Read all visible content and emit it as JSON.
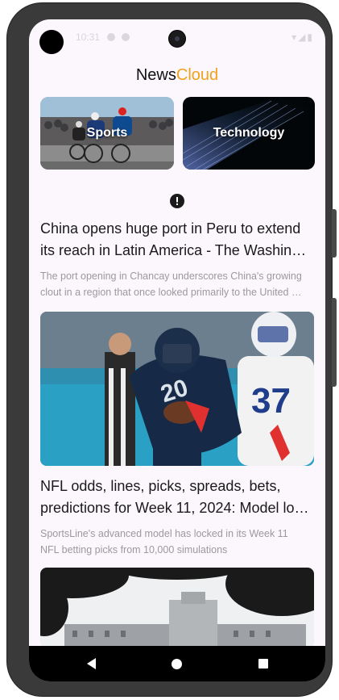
{
  "status_bar": {
    "time": "10:31"
  },
  "app": {
    "title_prefix": "News",
    "title_accent": "Cloud",
    "accent_color": "#f2a11b"
  },
  "categories": [
    {
      "label": "Sports"
    },
    {
      "label": "Technology"
    }
  ],
  "error_icon": "error-exclamation-icon",
  "articles": [
    {
      "title_line1": "China opens huge port in Peru to extend",
      "title_line2": "its reach in Latin America - The Washin…",
      "desc_line1": "The port opening in Chancay underscores China's growing",
      "desc_line2": "clout in a region that once looked primarily to the United …"
    },
    {
      "title_line1": "NFL odds, lines, picks, spreads, bets,",
      "title_line2": "predictions for Week 11, 2024: Model lo…",
      "desc_line1": "SportsLine's advanced model has locked in its Week 11",
      "desc_line2": "NFL betting picks from 10,000 simulations"
    }
  ],
  "nav": {
    "back": "back-icon",
    "home": "home-icon",
    "recents": "recents-icon"
  }
}
